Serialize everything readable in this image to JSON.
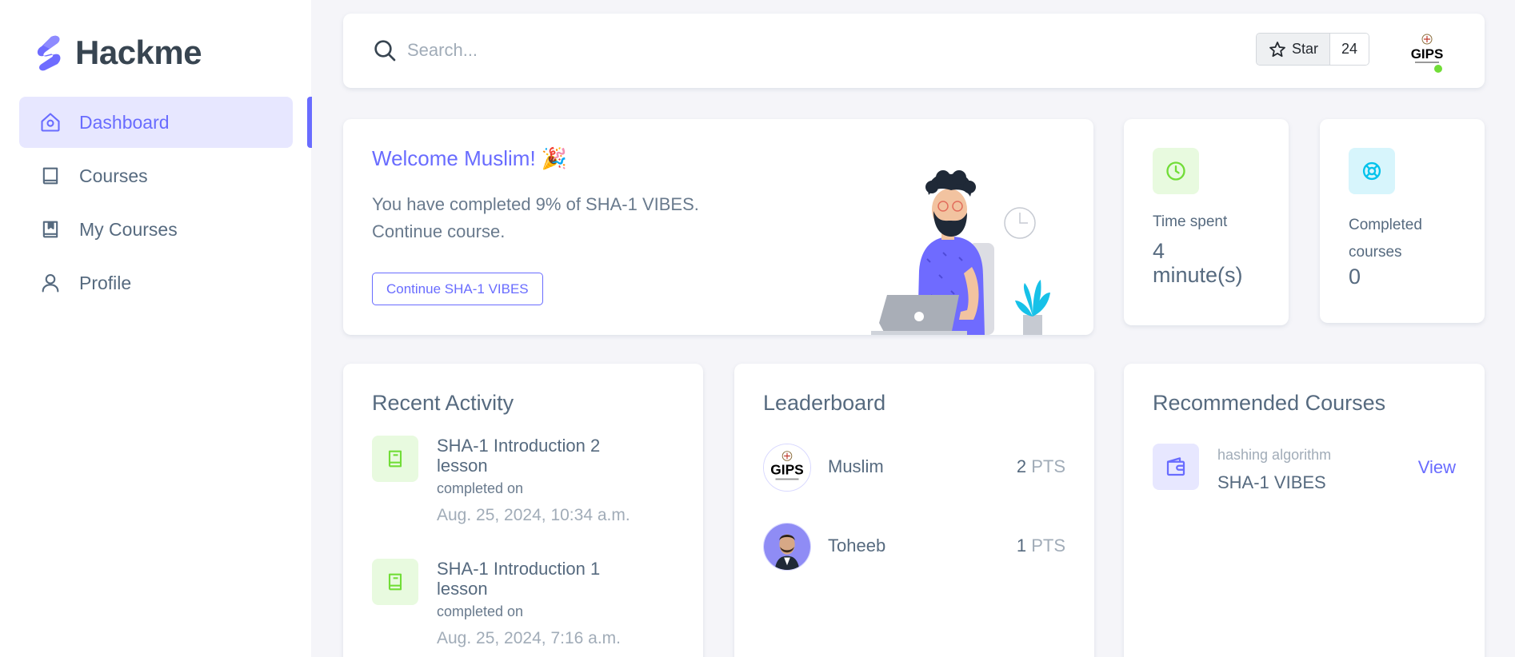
{
  "brand": {
    "name": "Hackme",
    "accent": "#696cff"
  },
  "sidebar": {
    "items": [
      {
        "label": "Dashboard",
        "icon": "home-icon",
        "active": true
      },
      {
        "label": "Courses",
        "icon": "book-icon",
        "active": false
      },
      {
        "label": "My Courses",
        "icon": "bookmark-book-icon",
        "active": false
      },
      {
        "label": "Profile",
        "icon": "user-icon",
        "active": false
      }
    ]
  },
  "navbar": {
    "search_placeholder": "Search...",
    "star_label": "Star",
    "star_count": "24",
    "avatar_text": "GIPS"
  },
  "welcome": {
    "title": "Welcome Muslim! 🎉",
    "line1": "You have completed 9% of SHA-1 VIBES.",
    "line2": "Continue course.",
    "button": "Continue SHA-1 VIBES"
  },
  "stats": {
    "time_label": "Time spent",
    "time_value_line1": "4",
    "time_value_line2": "minute(s)",
    "completed_label_line1": "Completed",
    "completed_label_line2": "courses",
    "completed_value": "0"
  },
  "activity": {
    "title": "Recent Activity",
    "items": [
      {
        "title": "SHA-1 Introduction 2 lesson",
        "sub": "completed on",
        "date": "Aug. 25, 2024, 10:34 a.m."
      },
      {
        "title": "SHA-1 Introduction 1 lesson",
        "sub": "completed on",
        "date": "Aug. 25, 2024, 7:16 a.m."
      }
    ]
  },
  "leaderboard": {
    "title": "Leaderboard",
    "rows": [
      {
        "name": "Muslim",
        "points": "2",
        "unit": "PTS",
        "avatar": "GIPS"
      },
      {
        "name": "Toheeb",
        "points": "1",
        "unit": "PTS",
        "avatar": "photo"
      }
    ]
  },
  "recommended": {
    "title": "Recommended Courses",
    "items": [
      {
        "category": "hashing algorithm",
        "name": "SHA-1 VIBES",
        "action": "View",
        "icon": "wallet-icon"
      }
    ]
  }
}
